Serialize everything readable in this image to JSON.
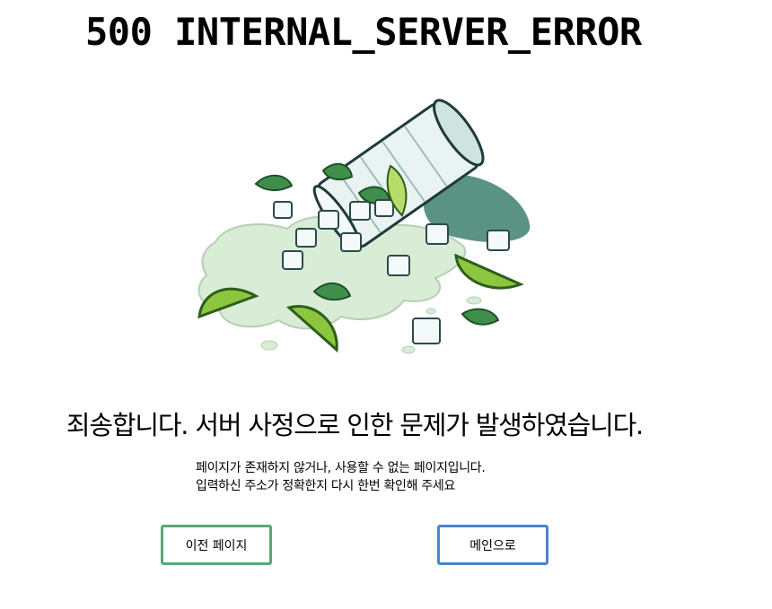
{
  "error": {
    "code_text": "500 INTERNAL_SERVER_ERROR"
  },
  "message": {
    "headline": "죄송합니다. 서버 사정으로 인한 문제가 발생하였습니다.",
    "line1": "페이지가 존재하지 않거나, 사용할 수 없는 페이지입니다.",
    "line2": "입력하신 주소가 정확한지 다시 한번 확인해 주세요"
  },
  "buttons": {
    "prev_label": "이전 페이지",
    "main_label": "메인으로"
  },
  "colors": {
    "prev_border": "#5aa874",
    "main_border": "#4a86c8",
    "lime": "#8cc63f",
    "mint_leaf": "#3f8f4a",
    "water": "#d8ecd6",
    "glass": "#e9f3f2",
    "shadow": "#3d7f6e"
  },
  "illustration": {
    "icon": "spilled-mojito-glass-illustration"
  }
}
